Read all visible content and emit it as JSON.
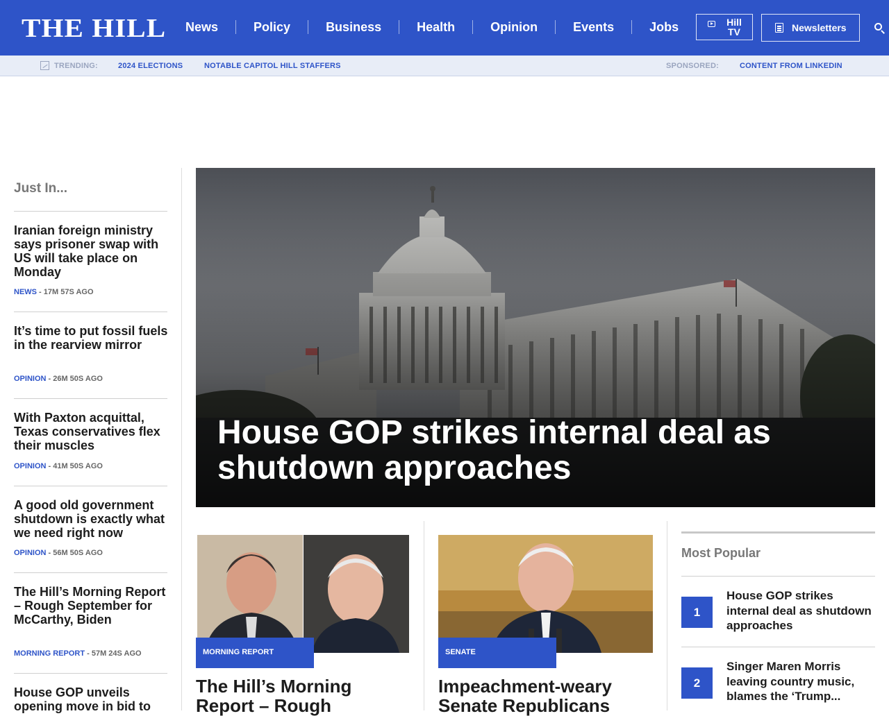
{
  "header": {
    "logo": "THE HILL",
    "nav": [
      "News",
      "Policy",
      "Business",
      "Health",
      "Opinion",
      "Events",
      "Jobs"
    ],
    "hill_tv_line1": "Hill",
    "hill_tv_line2": "TV",
    "newsletters": "Newsletters"
  },
  "trending": {
    "label": "TRENDING:",
    "links": [
      "2024 ELECTIONS",
      "NOTABLE CAPITOL HILL STAFFERS"
    ],
    "sponsored_label": "SPONSORED:",
    "sponsored_link": "CONTENT FROM LINKEDIN"
  },
  "just_in": {
    "title": "Just In...",
    "items": [
      {
        "headline": "Iranian foreign ministry says prisoner swap with US will take place on Monday",
        "category": "NEWS",
        "time": " - 17M 57S AGO"
      },
      {
        "headline": "It’s time to put fossil fuels in the rearview mirror",
        "category": "OPINION",
        "time": " - 26M 50S AGO"
      },
      {
        "headline": "With Paxton acquittal, Texas conservatives flex their muscles",
        "category": "OPINION",
        "time": " - 41M 50S AGO"
      },
      {
        "headline": "A good old government shutdown is exactly what we need right now",
        "category": "OPINION",
        "time": " - 56M 50S AGO"
      },
      {
        "headline": "The Hill’s Morning Report – Rough September for McCarthy, Biden",
        "category": "MORNING REPORT",
        "time": " - 57M 24S AGO"
      },
      {
        "headline": "House GOP unveils opening move in bid to",
        "category": "",
        "time": ""
      }
    ]
  },
  "hero": {
    "headline": "House GOP strikes internal deal as shutdown approaches"
  },
  "cards": [
    {
      "tag": "MORNING REPORT",
      "headline": "The Hill’s Morning Report – Rough"
    },
    {
      "tag": "SENATE",
      "headline": "Impeachment-weary Senate Republicans"
    }
  ],
  "most_popular": {
    "title": "Most Popular",
    "items": [
      {
        "rank": "1",
        "headline": "House GOP strikes internal deal as shutdown approaches"
      },
      {
        "rank": "2",
        "headline": "Singer Maren Morris leaving country music, blames the ‘Trump..."
      }
    ]
  },
  "colors": {
    "brand_blue": "#2e54c8",
    "trend_bar": "#e8edf7"
  }
}
